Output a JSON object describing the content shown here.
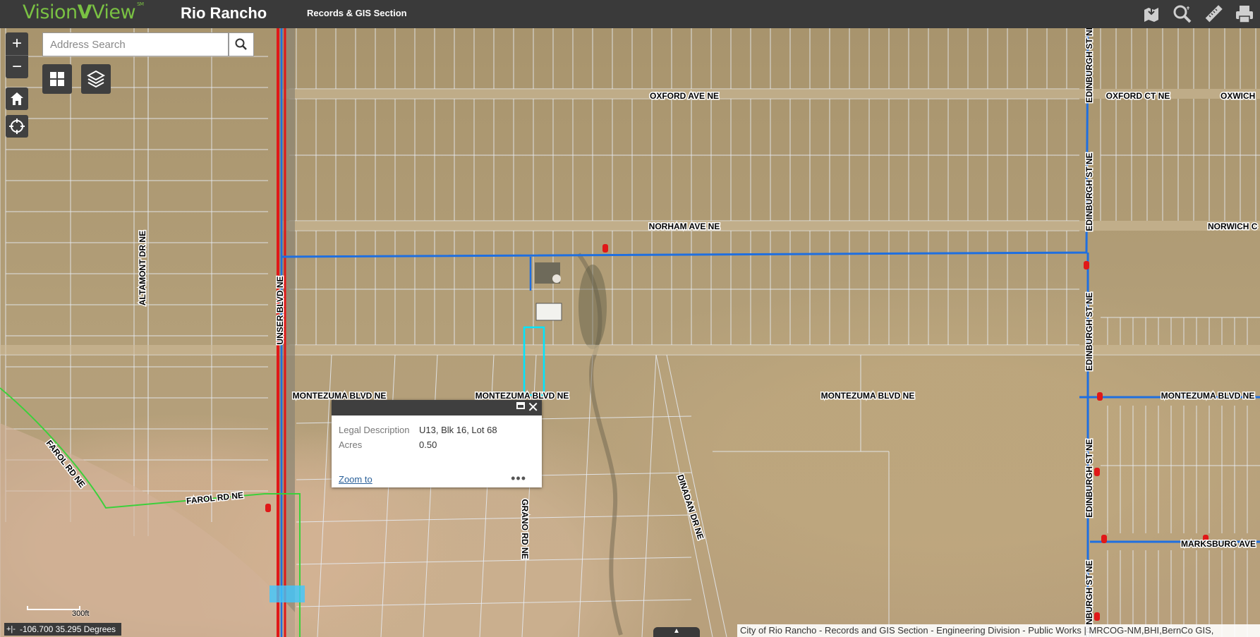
{
  "header": {
    "logo_text_1": "Vision",
    "logo_v": "V",
    "logo_text_2": "View",
    "logo_sm": "SM",
    "title": "Rio Rancho",
    "section": "Records & GIS Section"
  },
  "toolbar": {
    "icons": [
      "save-map-icon",
      "search-icon",
      "measure-ruler-icon",
      "print-icon"
    ]
  },
  "map_controls": {
    "zoom_in": "+",
    "zoom_out": "−"
  },
  "search": {
    "placeholder": "Address Search"
  },
  "streets": {
    "oxford_ave": "OXFORD AVE NE",
    "oxford_ct": "OXFORD CT NE",
    "oxwich": "OXWICH",
    "norham_ave": "NORHAM AVE NE",
    "norwich": "NORWICH C",
    "montezuma_1": "MONTEZUMA BLVD NE",
    "montezuma_2": "MONTEZUMA BLVD NE",
    "montezuma_3": "MONTEZUMA BLVD NE",
    "montezuma_4": "MONTEZUMA BLVD NE",
    "altamont": "ALTAMONT DR NE",
    "unser": "UNSER BLVD NE",
    "farol_1": "FAROL RD NE",
    "farol_2": "FAROL RD NE",
    "grano": "GRANO RD NE",
    "dinadan": "DINADAN DR NE",
    "edinburgh_1": "EDINBURGH ST NE",
    "edinburgh_2": "EDINBURGH ST NE",
    "edinburgh_3": "EDINBURGH ST NE",
    "edinburgh_4": "EDINBURGH ST NE",
    "edinburgh_5": "EDINBURGH ST NE",
    "marksburg": "MARKSBURG AVE"
  },
  "popup": {
    "rows": [
      {
        "label": "Legal Description",
        "value": "U13, Blk 16, Lot 68"
      },
      {
        "label": "Acres",
        "value": "0.50"
      }
    ],
    "zoom_to": "Zoom to",
    "more": "•••"
  },
  "status": {
    "coords": "-106.700 35.295 Degrees",
    "scale": "300ft",
    "attribution": "City of Rio Rancho - Records and GIS Section - Engineering Division - Public Works | MRCOG-NM,BHI,BernCo GIS,"
  },
  "colors": {
    "header_bg": "#3a3a3a",
    "logo_green": "#7ac143",
    "water_main": "#1f6fe0",
    "sewer_red": "#e01818",
    "selected_parcel": "#00e5ff"
  }
}
